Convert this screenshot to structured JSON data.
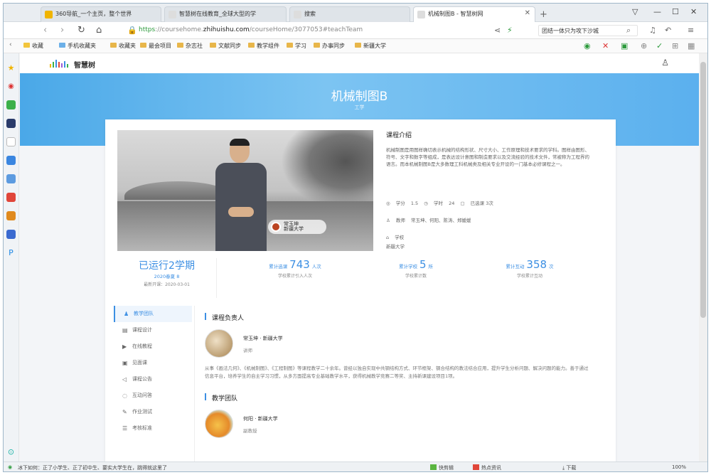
{
  "browser": {
    "tabs": [
      {
        "label": "360导航_一个主页，整个世界",
        "color": "#f0b400"
      },
      {
        "label": "智慧树在线教育_全球大型的学",
        "color": "#cccccc"
      },
      {
        "label": "搜索",
        "color": "#cccccc"
      },
      {
        "label": "机械制图B - 智慧树网",
        "color": "#cccccc"
      }
    ],
    "new_tab": "+",
    "window_controls": [
      "▽",
      "—",
      "☐",
      "✕"
    ],
    "nav": {
      "back": "‹",
      "forward": "›",
      "refresh": "↻",
      "home": "⌂"
    },
    "url": {
      "scheme": "https",
      "prefix": "://coursehome.",
      "domain": "zhihuishu.com",
      "path": "/courseHome/3077053#teachTeam"
    },
    "search_text": "团结一体只为攻下沙城",
    "bookmarks": [
      "收藏",
      "手机收藏夹",
      "收藏夹",
      "最会项目",
      "杂志社",
      "文献同步",
      "教学组件",
      "学习",
      "办事同步",
      "新疆大学"
    ]
  },
  "site": {
    "logo": "智慧树",
    "hero_title": "机械制图B",
    "hero_sub": "工学"
  },
  "course": {
    "intro_title": "课程介绍",
    "intro_text": "机械制图是用图样确切表示机械的结构形状、尺寸大小、工作原理和技术要求的学科。图样由图形、符号、文字和数字等组成，是表达设计意图和制造要求以及交流经验的技术文件，常被称为工程界的语言。而本机械制图B是大多数理工科机械类及相关专业开设的一门基本必修课程之一。",
    "credit_label": "学分",
    "credit": "1.5",
    "hours_label": "学时",
    "hours": "24",
    "tag": "已选课 3次",
    "teachers_label": "教师",
    "teachers": "常玉坤、何阳、陈涛、郑媛媛",
    "school_label": "学校",
    "school": "新疆大学",
    "presenter": "常玉坤",
    "presenter_org": "新疆大学"
  },
  "stats": {
    "run": {
      "value": "已运行2学期",
      "small": "2020春夏 8",
      "date": "最新开课：2020-03-01"
    },
    "schools": {
      "label": "累计选课",
      "value": "743",
      "unit": "人次",
      "sub": "学校累计引入人次"
    },
    "schools2": {
      "label": "累计学校",
      "value": "5",
      "unit": "所",
      "sub": "学校累计数"
    },
    "interact": {
      "label": "累计互动",
      "value": "358",
      "unit": "次",
      "sub": "学校累计互动"
    }
  },
  "menu": [
    {
      "label": "教学团队",
      "icon": "team-icon"
    },
    {
      "label": "课程设计",
      "icon": "design-icon"
    },
    {
      "label": "在线教程",
      "icon": "tutorial-icon"
    },
    {
      "label": "见面课",
      "icon": "meeting-icon"
    },
    {
      "label": "课程公告",
      "icon": "notice-icon"
    },
    {
      "label": "互动问答",
      "icon": "qa-icon"
    },
    {
      "label": "作业测试",
      "icon": "test-icon"
    },
    {
      "label": "考核标准",
      "icon": "exam-icon"
    }
  ],
  "team": {
    "leader_title": "课程负责人",
    "leader_name": "常玉坤 · 新疆大学",
    "leader_role": "讲师",
    "leader_bio": "从事《画法几何》、《机械制图》、《工程制图》等课程教学二十余年。曾经以独自实现中共钢结构方式、环节框架、钢合结构的教法结合应用，提升学生分析问题、解决问题的能力。善于通过信息平台，培养学生的自主学习习惯，从多方面提高专业基础教学水平，获得机械教学竞赛二等奖、主持新课建设项目1项。",
    "team_title": "教学团队",
    "member_name": "何阳 · 新疆大学",
    "member_role": "副教授"
  },
  "statusbar": {
    "news": "冰下如何：正了小学生、正了初中生、要实大学生在，跳得就这里了",
    "left_items": [
      "快剪辑",
      "热点资讯",
      "下载",
      "100%"
    ]
  }
}
